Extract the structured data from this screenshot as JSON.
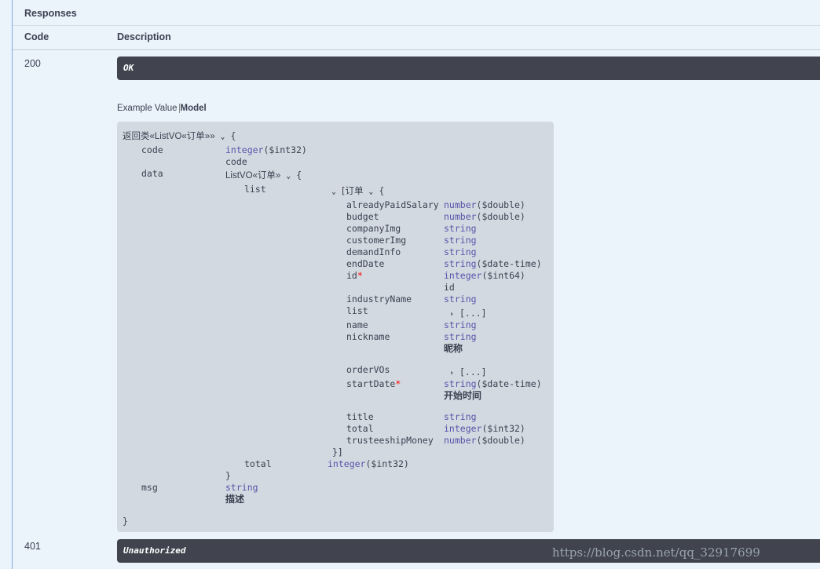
{
  "responses": {
    "title": "Responses",
    "col_code": "Code",
    "col_description": "Description",
    "items": [
      {
        "code": "200",
        "description": "OK"
      },
      {
        "code": "401",
        "description": "Unauthorized"
      }
    ]
  },
  "tabs": {
    "example_value": "Example Value",
    "model": "Model"
  },
  "model": {
    "name": "返回类«ListVO«订单»»",
    "open_brace": "{",
    "close_brace": "}",
    "props": {
      "code": {
        "name": "code",
        "type": "integer",
        "format": "($int32)",
        "desc": "code"
      },
      "data": {
        "name": "data",
        "ref": "ListVO«订单»",
        "open": "{",
        "close": "}"
      },
      "list": {
        "name": "list",
        "ref": "[订单",
        "open": "{",
        "close": "}]"
      },
      "total_outer": {
        "name": "total",
        "type": "integer",
        "format": "($int32)"
      },
      "msg": {
        "name": "msg",
        "type": "string",
        "desc": "描述"
      }
    },
    "order_fields": [
      {
        "name": "alreadyPaidSalary",
        "type": "number",
        "format": "($double)"
      },
      {
        "name": "budget",
        "type": "number",
        "format": "($double)"
      },
      {
        "name": "companyImg",
        "type": "string"
      },
      {
        "name": "customerImg",
        "type": "string"
      },
      {
        "name": "demandInfo",
        "type": "string"
      },
      {
        "name": "endDate",
        "type": "string",
        "format": "($date-time)"
      },
      {
        "name": "id",
        "required": "*",
        "type": "integer",
        "format": "($int64)",
        "desc": "id"
      },
      {
        "name": "industryName",
        "type": "string"
      },
      {
        "name": "list",
        "collapsed": "[...]"
      },
      {
        "name": "name",
        "type": "string"
      },
      {
        "name": "nickname",
        "type": "string",
        "desc": "昵称"
      },
      {
        "name": "orderVOs",
        "collapsed": "[...]"
      },
      {
        "name": "startDate",
        "required": "*",
        "type": "string",
        "format": "($date-time)",
        "desc": "开始时间"
      },
      {
        "name": "title",
        "type": "string"
      },
      {
        "name": "total",
        "type": "integer",
        "format": "($int32)"
      },
      {
        "name": "trusteeshipMoney",
        "type": "number",
        "format": "($double)"
      }
    ]
  },
  "icons": {
    "expanded": "chevron-down-icon",
    "collapsed": "chevron-right-icon"
  },
  "watermark": "https://blog.csdn.net/qq_32917699"
}
